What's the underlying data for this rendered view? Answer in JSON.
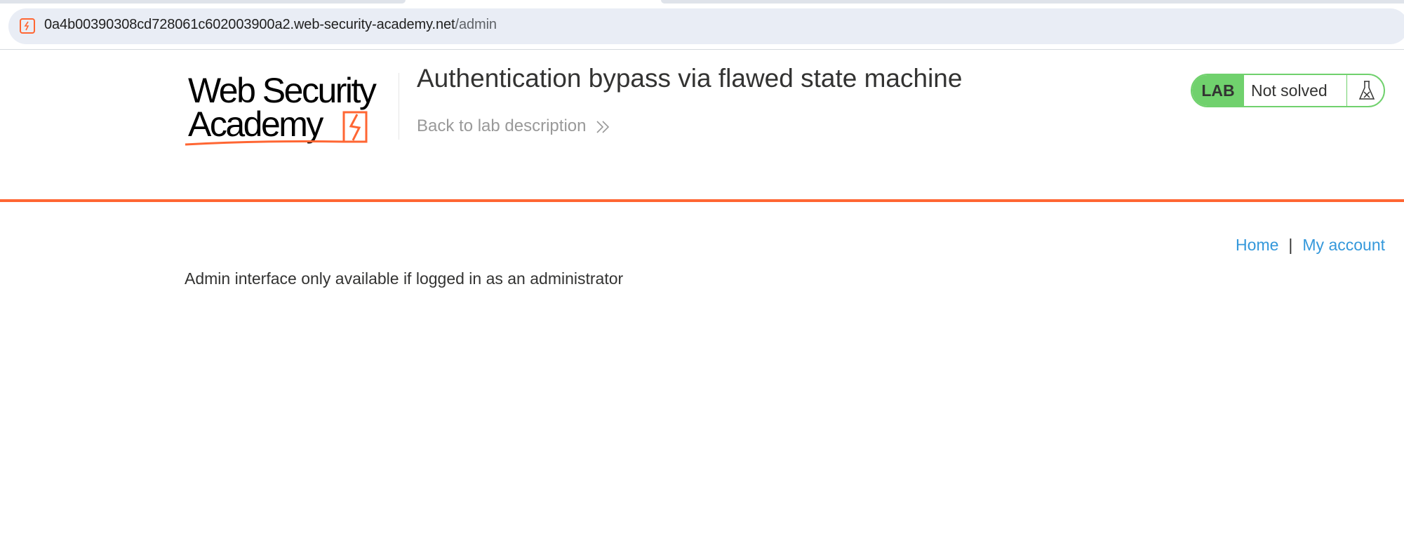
{
  "browser": {
    "url_host": "0a4b00390308cd728061c602003900a2.web-security-academy.net",
    "url_path": "/admin"
  },
  "header": {
    "logo_text": "Web Security Academy",
    "title": "Authentication bypass via flawed state machine",
    "back_link": "Back to lab description"
  },
  "lab_status": {
    "badge": "LAB",
    "status": "Not solved"
  },
  "nav": {
    "home": "Home",
    "separator": "|",
    "my_account": "My account"
  },
  "content": {
    "message": "Admin interface only available if logged in as an administrator"
  },
  "colors": {
    "accent": "#ff6633",
    "lab_green": "#70d16d",
    "link": "#3498db"
  },
  "icons": {
    "site": "portswigger-favicon-icon",
    "back": "double-chevron-right-icon",
    "lab": "flask-icon"
  }
}
